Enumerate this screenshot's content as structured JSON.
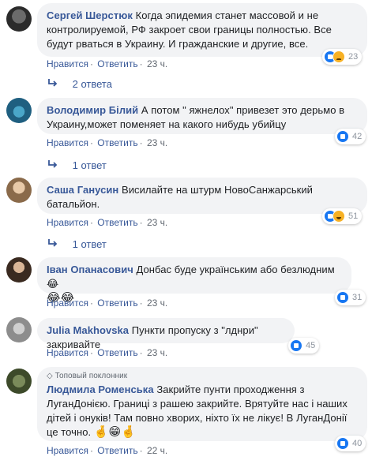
{
  "comments": [
    {
      "author": "Сергей Шерстюк",
      "text": "Когда эпидемия станет массовой и не контролируемой, РФ закроет свои границы полностью. Все будут рваться в Украину. И гражданские и другие, все.",
      "like": "Нравится",
      "reply": "Ответить",
      "time": "23 ч.",
      "reactions": "23",
      "reaction_icons": [
        "like-icon",
        "sad-icon"
      ],
      "replies": "2 ответа"
    },
    {
      "author": "Володимир Білий",
      "text": "А потом \" яжнелох\" привезет это дерьмо в Украину,может поменяет на какого нибудь убийцу",
      "like": "Нравится",
      "reply": "Ответить",
      "time": "23 ч.",
      "reactions": "42",
      "reaction_icons": [
        "like-icon"
      ],
      "replies": "1 ответ"
    },
    {
      "author": "Саша Ганусин",
      "text": "Висилайте на штурм НовоСанжарський батальйон.",
      "like": "Нравится",
      "reply": "Ответить",
      "time": "23 ч.",
      "reactions": "51",
      "reaction_icons": [
        "like-icon",
        "haha-icon"
      ],
      "replies": "1 ответ"
    },
    {
      "author": "Іван Опанасович",
      "text": "Донбас буде українським або безлюдним 😂",
      "emoji": "😂😂",
      "like": "Нравится",
      "reply": "Ответить",
      "time": "23 ч.",
      "reactions": "31",
      "reaction_icons": [
        "like-icon"
      ]
    },
    {
      "author": "Julia Makhovska",
      "text": "Пункти пропуску з \"лднри\" закривайте",
      "like": "Нравится",
      "reply": "Ответить",
      "time": "23 ч.",
      "reactions": "45",
      "reaction_icons": [
        "like-icon"
      ]
    },
    {
      "badge": "Топовый поклонник",
      "badge_icon": "diamond-icon",
      "author": "Людмила Роменська",
      "text": "Закрийте пунти проходження з ЛуганДонією. Границі з рашею закрийте. Врятуйте нас і наших дітей і онуків! Там повно хворих, ніхто їх не лікує! В ЛуганДонії це точно.",
      "emoji": "🤞😁🤞",
      "like": "Нравится",
      "reply": "Ответить",
      "time": "22 ч.",
      "reactions": "40",
      "reaction_icons": [
        "like-icon"
      ]
    }
  ],
  "colors": {
    "link": "#385898",
    "bubble": "#f2f3f5",
    "meta": "#606770",
    "like": "#1877f2"
  }
}
